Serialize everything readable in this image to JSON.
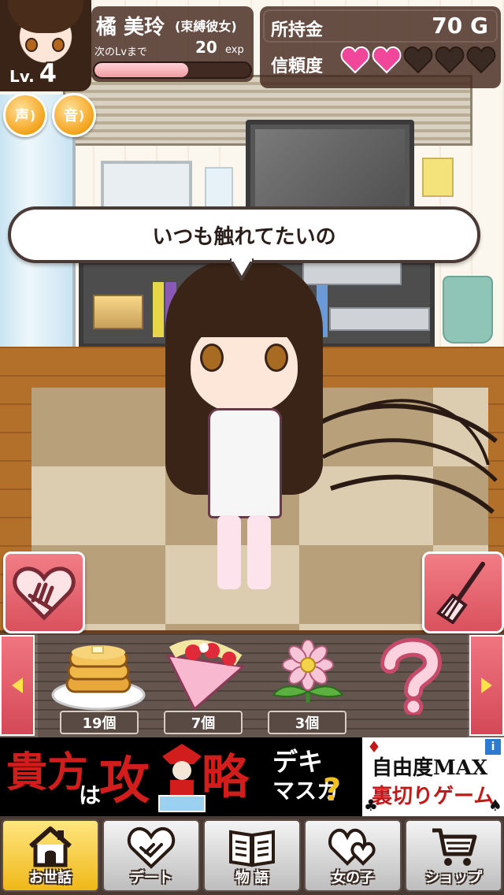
{
  "header": {
    "character_name": "橘 美玲",
    "character_type": "(束縛彼女)",
    "level_prefix": "Lv.",
    "level": "4",
    "next_level_label": "次のLvまで",
    "exp_remaining": "20",
    "exp_unit": "exp",
    "exp_progress": 0.6,
    "money_label": "所持金",
    "money_value": "70 G",
    "trust_label": "信頼度",
    "trust_filled": 2,
    "trust_max": 5
  },
  "sound_buttons": {
    "voice_label": "声",
    "sound_label": "音"
  },
  "speech": {
    "text": "いつも触れてたいの"
  },
  "items": [
    {
      "name": "pancakes",
      "count": "19個"
    },
    {
      "name": "crepe",
      "count": "7個"
    },
    {
      "name": "flower",
      "count": "3個"
    },
    {
      "name": "unknown",
      "count": ""
    }
  ],
  "ad": {
    "left_text_1": "貴方",
    "left_text_2": "は",
    "left_text_3": "攻",
    "left_text_4": "略",
    "left_text_5": "デキ",
    "left_text_6": "マスカ",
    "left_text_7": "?",
    "right_line_1": "自由度MAX",
    "right_line_2": "裏切りゲーム",
    "info_mark": "i"
  },
  "nav": [
    {
      "label": "お世話",
      "icon": "house-icon",
      "active": true
    },
    {
      "label": "デート",
      "icon": "handshake-heart-icon",
      "active": false
    },
    {
      "label": "物 語",
      "icon": "book-icon",
      "active": false
    },
    {
      "label": "女の子",
      "icon": "hearts-icon",
      "active": false
    },
    {
      "label": "ショップ",
      "icon": "cart-icon",
      "active": false
    }
  ],
  "colors": {
    "accent_pink": "#e8606c",
    "heart_filled": "#f0479a",
    "heart_empty": "#3a2a24",
    "gold": "#f4a31b"
  }
}
